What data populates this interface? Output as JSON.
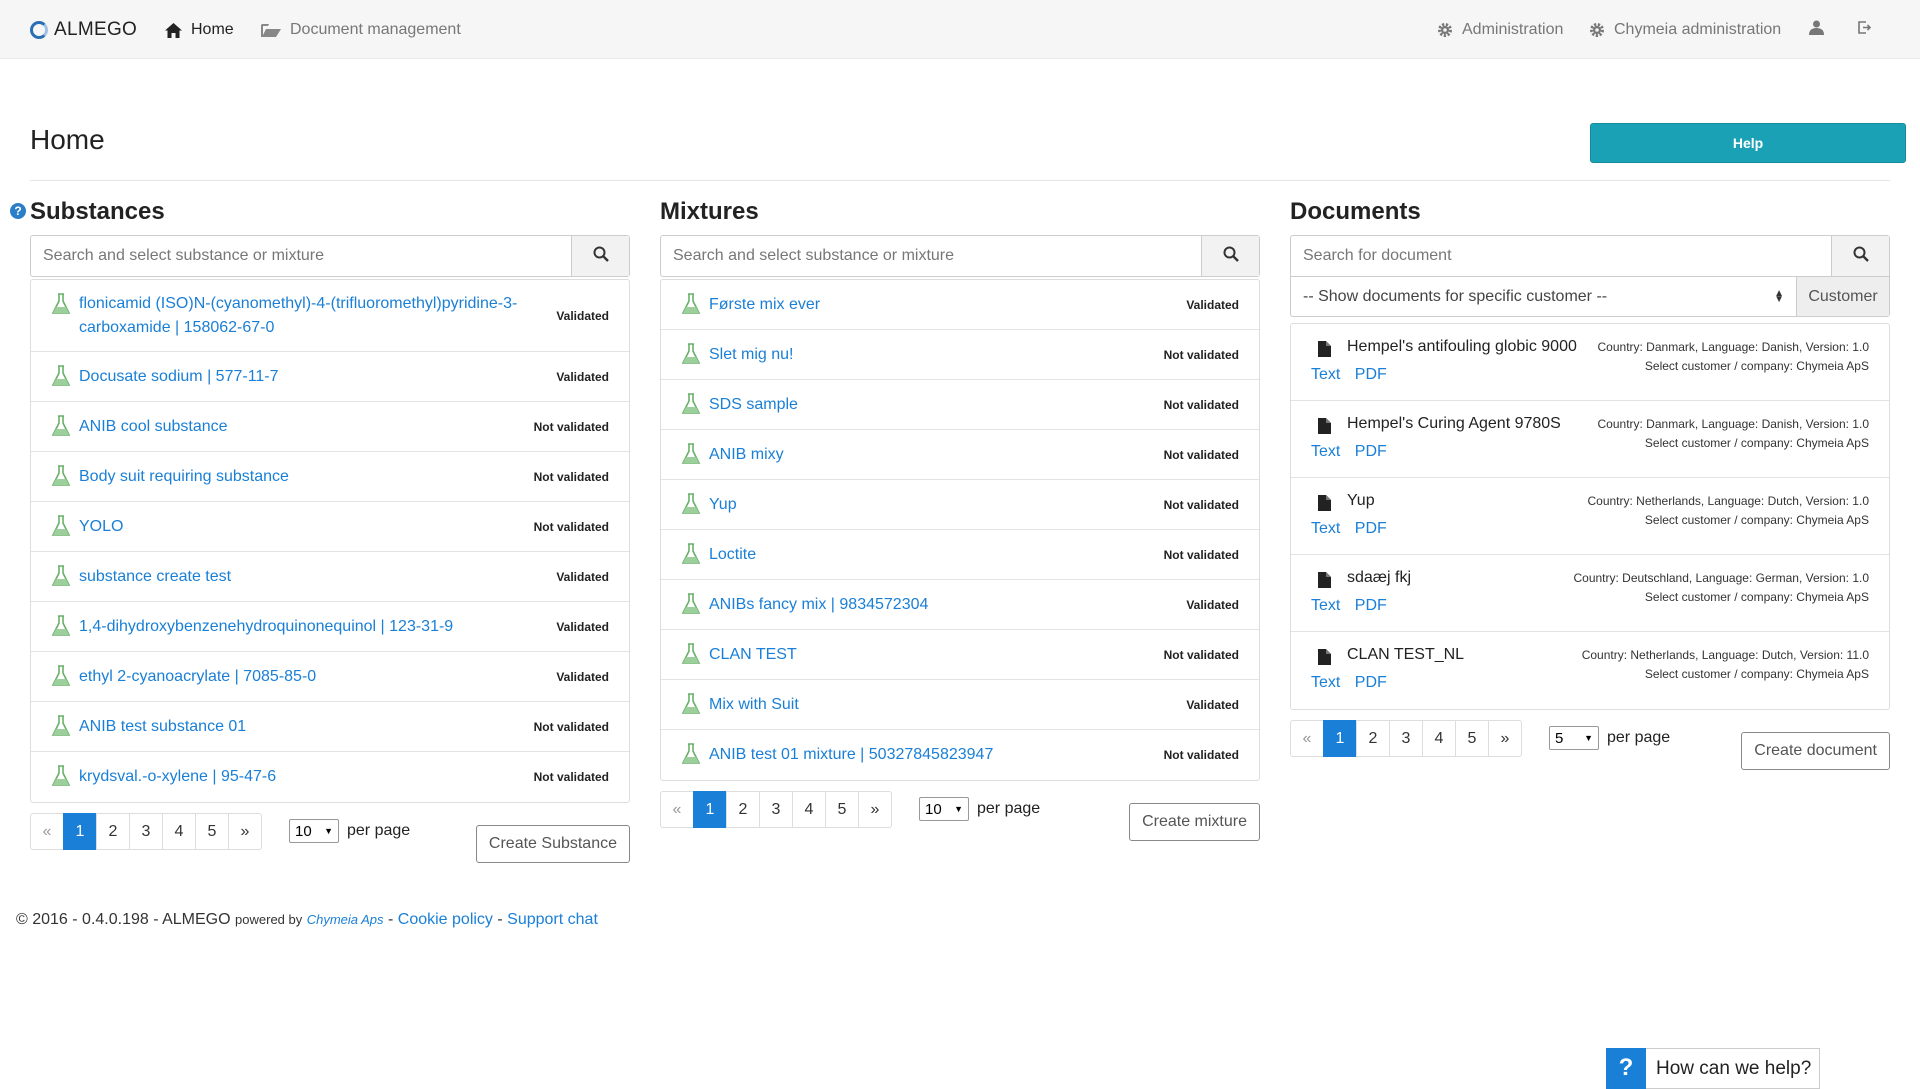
{
  "nav": {
    "brand": "ALMEGO",
    "home": "Home",
    "document_management": "Document management",
    "administration": "Administration",
    "chymeia_administration": "Chymeia administration"
  },
  "page": {
    "title": "Home",
    "help_label": "Help"
  },
  "substances": {
    "title": "Substances",
    "search_placeholder": "Search and select substance or mixture",
    "items": [
      {
        "name": "flonicamid (ISO)N-(cyanomethyl)-4-(trifluoromethyl)pyridine-3-carboxamide | 158062-67-0",
        "status": "Validated"
      },
      {
        "name": "Docusate sodium | 577-11-7",
        "status": "Validated"
      },
      {
        "name": "ANIB cool substance",
        "status": "Not validated"
      },
      {
        "name": "Body suit requiring substance",
        "status": "Not validated"
      },
      {
        "name": "YOLO",
        "status": "Not validated"
      },
      {
        "name": "substance create test",
        "status": "Validated"
      },
      {
        "name": "1,4-dihydroxybenzenehydroquinonequinol | 123-31-9",
        "status": "Validated"
      },
      {
        "name": "ethyl 2-cyanoacrylate | 7085-85-0",
        "status": "Validated"
      },
      {
        "name": "ANIB test substance 01",
        "status": "Not validated"
      },
      {
        "name": "krydsval.-o-xylene | 95-47-6",
        "status": "Not validated"
      }
    ],
    "pages": [
      "«",
      "1",
      "2",
      "3",
      "4",
      "5",
      "»"
    ],
    "active_page": "1",
    "per_page": "10",
    "per_page_label": "per page",
    "create_label": "Create Substance"
  },
  "mixtures": {
    "title": "Mixtures",
    "search_placeholder": "Search and select substance or mixture",
    "items": [
      {
        "name": "Første mix ever",
        "status": "Validated"
      },
      {
        "name": "Slet mig nu!",
        "status": "Not validated"
      },
      {
        "name": "SDS sample",
        "status": "Not validated"
      },
      {
        "name": "ANIB mixy",
        "status": "Not validated"
      },
      {
        "name": "Yup",
        "status": "Not validated"
      },
      {
        "name": "Loctite",
        "status": "Not validated"
      },
      {
        "name": "ANIBs fancy mix | 9834572304",
        "status": "Validated"
      },
      {
        "name": "CLAN TEST",
        "status": "Not validated"
      },
      {
        "name": "Mix with Suit",
        "status": "Validated"
      },
      {
        "name": "ANIB test 01 mixture | 50327845823947",
        "status": "Not validated"
      }
    ],
    "pages": [
      "«",
      "1",
      "2",
      "3",
      "4",
      "5",
      "»"
    ],
    "active_page": "1",
    "per_page": "10",
    "per_page_label": "per page",
    "create_label": "Create mixture"
  },
  "documents": {
    "title": "Documents",
    "search_placeholder": "Search for document",
    "customer_select": "-- Show documents for specific customer --",
    "customer_button": "Customer",
    "items": [
      {
        "name": "Hempel's antifouling globic 9000",
        "meta1": "Country: Danmark, Language: Danish, Version: 1.0",
        "meta2": "Select customer / company: Chymeia ApS",
        "text_link": "Text",
        "pdf_link": "PDF"
      },
      {
        "name": "Hempel's Curing Agent 9780S",
        "meta1": "Country: Danmark, Language: Danish, Version: 1.0",
        "meta2": "Select customer / company: Chymeia ApS",
        "text_link": "Text",
        "pdf_link": "PDF"
      },
      {
        "name": "Yup",
        "meta1": "Country: Netherlands, Language: Dutch, Version: 1.0",
        "meta2": "Select customer / company: Chymeia ApS",
        "text_link": "Text",
        "pdf_link": "PDF"
      },
      {
        "name": "sdaæj fkj",
        "meta1": "Country: Deutschland, Language: German, Version: 1.0",
        "meta2": "Select customer / company: Chymeia ApS",
        "text_link": "Text",
        "pdf_link": "PDF"
      },
      {
        "name": "CLAN TEST_NL",
        "meta1": "Country: Netherlands, Language: Dutch, Version: 11.0",
        "meta2": "Select customer / company: Chymeia ApS",
        "text_link": "Text",
        "pdf_link": "PDF"
      }
    ],
    "pages": [
      "«",
      "1",
      "2",
      "3",
      "4",
      "5",
      "»"
    ],
    "active_page": "1",
    "per_page": "5",
    "per_page_label": "per page",
    "create_label": "Create document"
  },
  "footer": {
    "copyright": "© 2016 - 0.4.0.198 - ALMEGO",
    "powered_by": "powered by",
    "company": "Chymeia Aps",
    "sep1": "-",
    "cookie_policy": "Cookie policy",
    "sep2": "-",
    "support_chat": "Support chat"
  },
  "chat": {
    "icon_text": "?",
    "label": "How can we help?"
  },
  "colors": {
    "accent": "#1a7fd6",
    "help_button": "#1ba1b5",
    "navbar_bg": "#f6f6f6"
  }
}
